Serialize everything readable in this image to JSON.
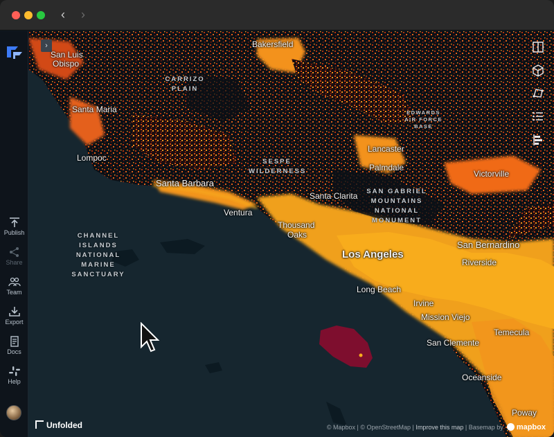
{
  "sidebar": {
    "items": [
      {
        "name": "publish",
        "label": "Publish"
      },
      {
        "name": "share",
        "label": "Share"
      },
      {
        "name": "team",
        "label": "Team"
      },
      {
        "name": "export",
        "label": "Export"
      },
      {
        "name": "docs",
        "label": "Docs"
      },
      {
        "name": "help",
        "label": "Help"
      }
    ]
  },
  "map": {
    "cities": [
      "San Luis",
      "Obispo",
      "Bakersfield",
      "Santa Maria",
      "Lompoc",
      "Santa Barbara",
      "Ventura",
      "Thousand",
      "Oaks",
      "Santa Clarita",
      "Lancaster",
      "Palmdale",
      "Victorville",
      "Los Angeles",
      "San Bernardino",
      "Riverside",
      "Long Beach",
      "Irvine",
      "Mission Viejo",
      "San Clemente",
      "Temecula",
      "Oceanside",
      "Poway"
    ],
    "regions": [
      "CARRIZO",
      "PLAIN",
      "SESPE",
      "WILDERNESS",
      "SAN GABRIEL",
      "MOUNTAINS",
      "NATIONAL",
      "MONUMENT",
      "CHANNEL",
      "ISLANDS",
      "NATIONAL",
      "MARINE",
      "SANCTUARY",
      "EDWARDS",
      "AIR FORCE",
      "BASE"
    ],
    "colors": {
      "ocean": "#16262f",
      "land": "#0b1016",
      "low": "#c0380e",
      "mid": "#f06a14",
      "high": "#f8ac1c",
      "highlight": "#7e0e2e"
    }
  },
  "brand": {
    "name": "Unfolded"
  },
  "attribution": {
    "osm": "© Mapbox | © OpenStreetMap | ",
    "improve": "Improve this map",
    "basemap": " | Basemap by",
    "mapbox": "mapbox"
  }
}
